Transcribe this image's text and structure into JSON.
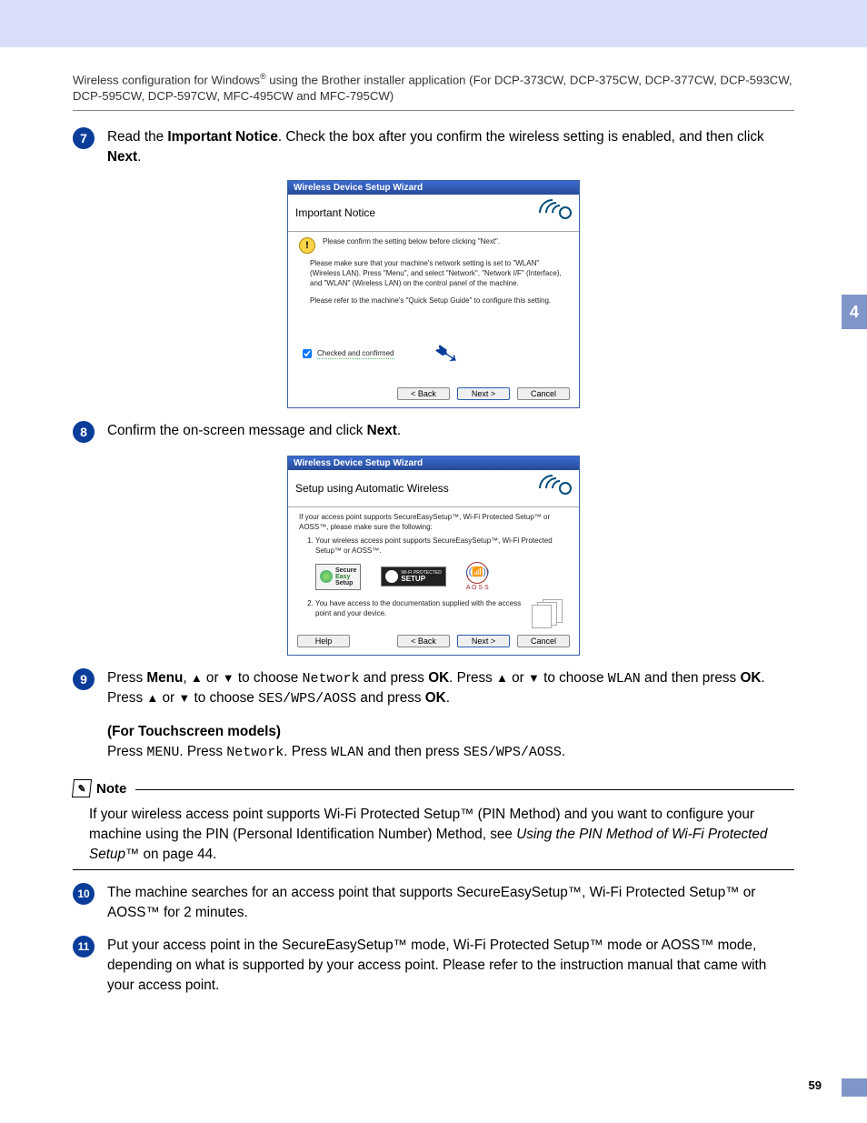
{
  "header": {
    "line": "Wireless configuration for Windows",
    "reg": "®",
    "line2": " using the Brother installer application (For DCP-373CW, DCP-375CW, DCP-377CW, DCP-593CW, DCP-595CW, DCP-597CW, MFC-495CW and MFC-795CW)"
  },
  "side_tab": "4",
  "page_number": "59",
  "steps": {
    "s7": {
      "num": "7",
      "t1": "Read the ",
      "t2": "Important Notice",
      "t3": ". Check the box after you confirm the wireless setting is enabled, and then click ",
      "t4": "Next",
      "t5": "."
    },
    "s8": {
      "num": "8",
      "t1": "Confirm the on-screen message and click ",
      "t2": "Next",
      "t3": "."
    },
    "s9": {
      "num": "9",
      "t1": "Press ",
      "menu": "Menu",
      "t2": ", ",
      "up": "▲",
      "t3": " or ",
      "dn": "▼",
      "t4": " to choose ",
      "network": "Network",
      "t5": " and press ",
      "ok": "OK",
      "t6": ". Press ",
      "t7": " to choose ",
      "wlan": "WLAN",
      "t8": " and then press ",
      "t9": ". Press ",
      "t10": " to choose ",
      "ses": "SES/WPS/AOSS",
      "t11": " and press ",
      "t12": ".",
      "ts_head": "(For Touchscreen models)",
      "ts1": "Press ",
      "ts_menu": "MENU",
      "ts2": ". Press ",
      "ts_net": "Network",
      "ts3": ". Press ",
      "ts_wlan": "WLAN",
      "ts4": " and then press ",
      "ts_ses": "SES/WPS/AOSS",
      "ts5": "."
    },
    "s10": {
      "num": "10",
      "t": "The machine searches for an access point that supports SecureEasySetup™, Wi-Fi Protected Setup™ or AOSS™ for 2 minutes."
    },
    "s11": {
      "num": "11",
      "t": "Put your access point in the SecureEasySetup™ mode, Wi-Fi Protected Setup™ mode or AOSS™ mode, depending on what is supported by your access point. Please refer to the instruction manual that came with your access point."
    }
  },
  "note": {
    "label": "Note",
    "t1": "If your wireless access point supports Wi-Fi Protected Setup™ (PIN Method) and you want to configure your machine using the PIN (Personal Identification Number) Method, see ",
    "link": "Using the PIN Method of Wi-Fi Protected Setup™",
    "t2": " on page 44."
  },
  "dlg1": {
    "title": "Wireless Device Setup Wizard",
    "head": "Important Notice",
    "warn": "Please confirm the setting below before clicking \"Next\".",
    "p1": "Please make sure that your machine's network setting is set to \"WLAN\" (Wireless LAN). Press \"Menu\", and select \"Network\", \"Network I/F\" (Interface), and \"WLAN\" (Wireless LAN) on the control panel of the machine.",
    "p2": "Please refer to the machine's \"Quick Setup Guide\" to configure this setting.",
    "check": "Checked and confirmed",
    "back": "< Back",
    "next": "Next >",
    "cancel": "Cancel"
  },
  "dlg2": {
    "title": "Wireless Device Setup Wizard",
    "head": "Setup using Automatic Wireless",
    "intro": "If your access point supports SecureEasySetup™, Wi-Fi Protected Setup™ or AOSS™, please make sure the following:",
    "li1": "Your wireless access point supports SecureEasySetup™, Wi-Fi Protected Setup™ or AOSS™.",
    "li2": "You have access to the documentation supplied with the access point and your device.",
    "ses_line1": "Secure",
    "ses_line2": "Easy",
    "ses_line3": "Setup",
    "wps_line1": "WI-FI PROTECTED",
    "wps_line2": "SETUP",
    "aoss": "A O S S",
    "help": "Help",
    "back": "< Back",
    "next": "Next >",
    "cancel": "Cancel"
  }
}
